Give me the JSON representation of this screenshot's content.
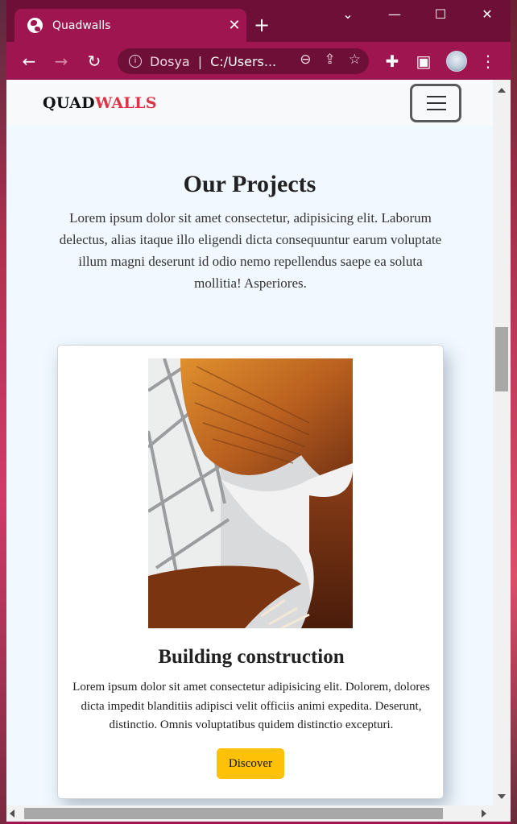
{
  "browser": {
    "tab_title": "Quadwalls",
    "tab_close": "✕",
    "new_tab": "+",
    "minimize": "—",
    "maximize": "☐",
    "close": "✕",
    "back": "←",
    "forward": "→",
    "reload": "↻",
    "omnibox_label": "Dosya",
    "omnibox_url": "C:/Users...",
    "zoom_icon": "⊖",
    "share_icon": "⇪",
    "bookmark_icon": "☆",
    "extensions_icon": "✚",
    "sidepanel_icon": "▣",
    "menu_icon": "⋮",
    "tablist_icon": "⌄"
  },
  "navbar": {
    "brand_part1": "QUAD",
    "brand_part2": "WALLS",
    "brand_color_2": "#dc3545"
  },
  "section": {
    "title": "Our Projects",
    "text": "Lorem ipsum dolor sit amet consectetur, adipisicing elit. Laborum delectus, alias itaque illo eligendi dicta consequuntur earum voluptate illum magni deserunt id odio nemo repellendus saepe ea soluta mollitia! Asperiores."
  },
  "card": {
    "title": "Building construction",
    "text": "Lorem ipsum dolor sit amet consectetur adipisicing elit. Dolorem, dolores dicta impedit blanditiis adipisci velit officiis animi expedita. Deserunt, distinctio. Omnis voluptatibus quidem distinctio excepturi.",
    "button_label": "Discover",
    "button_color": "#ffc107"
  },
  "colors": {
    "tabstrip": "#6d0f36",
    "toolbar": "#9e1550",
    "page_bg": "#f1f8ff"
  }
}
